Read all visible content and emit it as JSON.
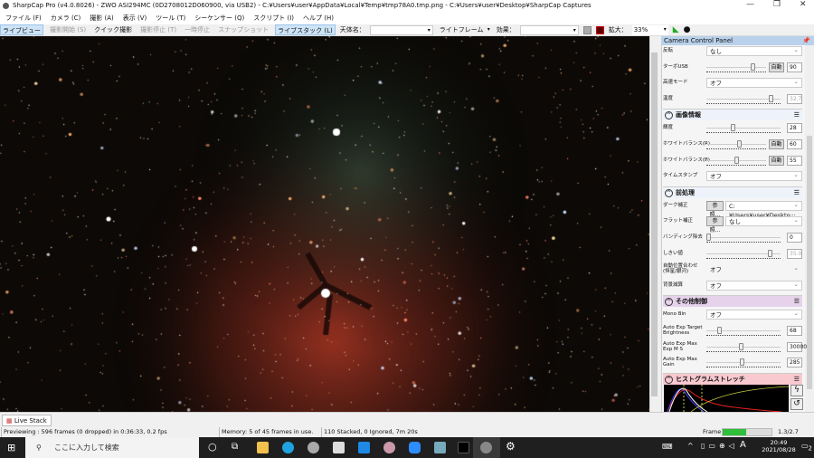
{
  "window": {
    "title": "SharpCap Pro (v4.0.8026) - ZWO ASI294MC (0D2708012D060900, via USB2) - C:¥Users¥user¥AppData¥Local¥Temp¥tmp78A0.tmp.png - C:¥Users¥user¥Desktop¥SharpCap Captures",
    "minimize": "—",
    "restore": "❐",
    "close": "✕"
  },
  "menu": [
    "ファイル (F)",
    "カメラ (C)",
    "撮影 (A)",
    "表示 (V)",
    "ツール (T)",
    "シーケンサー (Q)",
    "スクリプト (I)",
    "ヘルプ (H)"
  ],
  "toolbar": {
    "live_view": "ライブビュー",
    "start_capture": "撮影開始 (S)",
    "quick_capture": "クイック撮影",
    "stop_capture": "撮影停止 (T)",
    "pause": "一時停止",
    "snapshot": "スナップショット",
    "live_stack": "ライブスタック (L)",
    "target_label": "天体名：",
    "target_value": "",
    "frame_type": "ライトフレーム",
    "effect_label": "効果：",
    "effect_value": "",
    "zoom_label": "拡大：",
    "zoom_value": "33%"
  },
  "panel": {
    "title": "Camera Control Panel",
    "rows_top": [
      {
        "label": "反転",
        "type": "select",
        "value": "なし"
      },
      {
        "label": "ターボUSB",
        "type": "slider",
        "auto": "自動",
        "value": "90",
        "level": 0.8
      },
      {
        "label": "高速モード",
        "type": "select",
        "value": "オフ"
      },
      {
        "label": "温度",
        "type": "slider",
        "value": "32.7",
        "level": 0.9,
        "disabled": true
      }
    ],
    "sections": [
      {
        "title": "画像情報",
        "rows": [
          {
            "label": "輝度",
            "type": "slider",
            "value": "28",
            "level": 0.35
          },
          {
            "label": "ホワイトバランス(R)",
            "type": "slider",
            "auto": "自動",
            "value": "60",
            "level": 0.55
          },
          {
            "label": "ホワイトバランス(B)",
            "type": "slider",
            "auto": "自動",
            "value": "55",
            "level": 0.5
          },
          {
            "label": "タイムスタンプ",
            "type": "select",
            "value": "オフ"
          }
        ]
      },
      {
        "title": "前処理",
        "rows": [
          {
            "label": "ダーク補正",
            "type": "ref",
            "button": "参照...",
            "value": "C:¥Users¥user¥Deskto···"
          },
          {
            "label": "フラット補正",
            "type": "ref",
            "button": "参照...",
            "value": "なし"
          },
          {
            "label": "バンディング除去",
            "type": "slider",
            "value": "0",
            "level": 0.0
          },
          {
            "label": "しきい値",
            "type": "slider",
            "value": "35.0",
            "level": 0.88,
            "disabled": true
          },
          {
            "label": "自動位置合わせ (恒星/銀河)",
            "type": "select",
            "value": "オフ",
            "disabled": true
          },
          {
            "label": "背景減算",
            "type": "select",
            "value": "オフ"
          }
        ]
      },
      {
        "title": "その他制御",
        "color": "#e6d2ea",
        "rows": [
          {
            "label": "Mono Bin",
            "type": "select",
            "value": "オフ"
          },
          {
            "label": "Auto Exp Target Brightness",
            "type": "slider",
            "value": "68",
            "level": 0.15
          },
          {
            "label": "Auto Exp Max Exp M S",
            "type": "slider",
            "value": "30000",
            "level": 0.47
          },
          {
            "label": "Auto Exp Max Gain",
            "type": "slider",
            "value": "285",
            "level": 0.48
          }
        ]
      },
      {
        "title": "ヒストグラムストレッチ",
        "color": "#f9c9d0",
        "rows": []
      }
    ]
  },
  "tab": {
    "label": "Live Stack"
  },
  "status": {
    "preview": "Previewing : 596 frames (0 dropped) in 0:36:33, 0.2 fps",
    "memory": "Memory: 5 of 45 frames in use.",
    "stack": "110 Stacked, 0 Ignored, 7m 20s",
    "frame_label": "Frame:",
    "frame_value": "1.3/2.7",
    "frame_progress": 0.48
  },
  "taskbar": {
    "search_placeholder": "ここに入力して検索",
    "time": "20:49",
    "date": "2021/08/28",
    "ime": "A",
    "notifications": "2"
  }
}
